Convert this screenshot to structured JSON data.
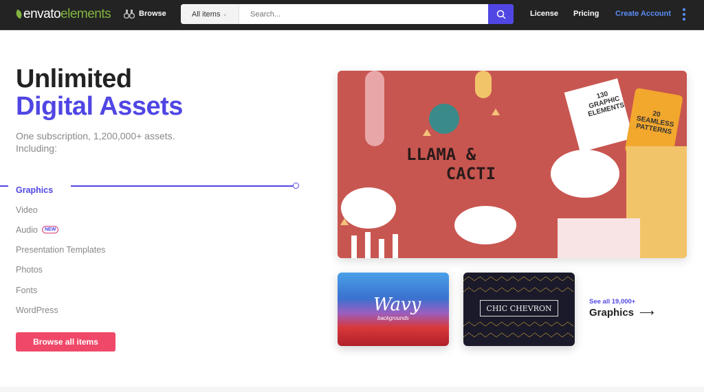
{
  "nav": {
    "logo_a": "envato",
    "logo_b": "elements",
    "browse": "Browse",
    "category": "All items",
    "search_placeholder": "Search...",
    "license": "License",
    "pricing": "Pricing",
    "create_account": "Create Account"
  },
  "hero": {
    "title_line1": "Unlimited",
    "title_line2": "Digital Assets",
    "subtitle": "One subscription, 1,200,000+ assets. Including:"
  },
  "categories": [
    {
      "label": "Graphics",
      "active": true
    },
    {
      "label": "Video"
    },
    {
      "label": "Audio",
      "badge": "NEW"
    },
    {
      "label": "Presentation Templates"
    },
    {
      "label": "Photos"
    },
    {
      "label": "Fonts"
    },
    {
      "label": "WordPress"
    }
  ],
  "cta": "Browse all items",
  "showcase": {
    "main_title_a": "LLAMA",
    "main_amp": "&",
    "main_title_b": "CACTI",
    "tag1": "130 GRAPHIC ELEMENTS",
    "tag2": "20 SEAMLESS PATTERNS",
    "thumb1_title": "Wavy",
    "thumb1_sub": "backgrounds",
    "thumb2_title": "CHIC CHEVRON",
    "see_all": "See all 19,000+",
    "see_all_cat": "Graphics"
  },
  "colors": {
    "accent": "#5046e4",
    "cta": "#f04868",
    "nav_bg": "#232323",
    "brand_green": "#82b541"
  }
}
